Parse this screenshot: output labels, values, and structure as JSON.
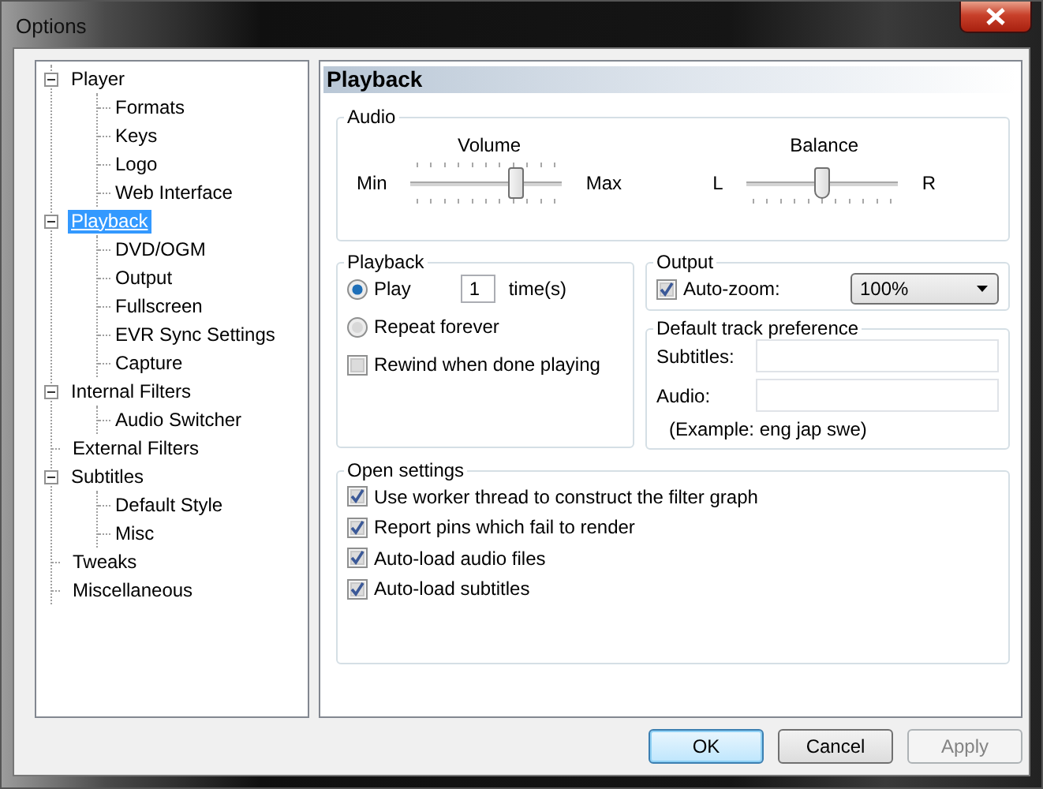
{
  "window": {
    "title": "Options"
  },
  "tree": [
    {
      "label": "Player",
      "selected": false,
      "expanded": true,
      "children": [
        {
          "label": "Formats",
          "selected": false
        },
        {
          "label": "Keys",
          "selected": false
        },
        {
          "label": "Logo",
          "selected": false
        },
        {
          "label": "Web Interface",
          "selected": false
        }
      ]
    },
    {
      "label": "Playback",
      "selected": true,
      "expanded": true,
      "children": [
        {
          "label": "DVD/OGM",
          "selected": false
        },
        {
          "label": "Output",
          "selected": false
        },
        {
          "label": "Fullscreen",
          "selected": false
        },
        {
          "label": "EVR Sync Settings",
          "selected": false
        },
        {
          "label": "Capture",
          "selected": false
        }
      ]
    },
    {
      "label": "Internal Filters",
      "selected": false,
      "expanded": true,
      "children": [
        {
          "label": "Audio Switcher",
          "selected": false
        }
      ]
    },
    {
      "label": "External Filters",
      "selected": false
    },
    {
      "label": "Subtitles",
      "selected": false,
      "expanded": true,
      "children": [
        {
          "label": "Default Style",
          "selected": false
        },
        {
          "label": "Misc",
          "selected": false
        }
      ]
    },
    {
      "label": "Tweaks",
      "selected": false
    },
    {
      "label": "Miscellaneous",
      "selected": false
    }
  ],
  "page": {
    "title": "Playback"
  },
  "audio": {
    "title": "Audio",
    "sliders": [
      {
        "label": "Volume",
        "min_label": "Min",
        "max_label": "Max",
        "level": 0.69,
        "kind": "block"
      },
      {
        "label": "Balance",
        "min_label": "L",
        "max_label": "R",
        "level": 0.5,
        "kind": "pointer"
      }
    ]
  },
  "playback": {
    "title": "Playback",
    "options": [
      {
        "kind": "radio",
        "label": "Play",
        "selected": true,
        "count": "1",
        "suffix": "time(s)"
      },
      {
        "kind": "radio",
        "label": "Repeat forever",
        "selected": false
      },
      {
        "kind": "checkbox",
        "label": "Rewind when done playing",
        "checked": false
      }
    ]
  },
  "output": {
    "title": "Output",
    "auto_zoom": {
      "label": "Auto-zoom:",
      "checked": true
    },
    "zoom": {
      "value": "100%"
    }
  },
  "track_preference": {
    "title": "Default track preference",
    "fields": [
      {
        "label": "Subtitles:"
      },
      {
        "label": "Audio:"
      }
    ],
    "example": "(Example: eng jap swe)"
  },
  "open_settings": {
    "title": "Open settings",
    "options": [
      {
        "label": "Use worker thread to construct the filter graph",
        "checked": true
      },
      {
        "label": "Report pins which fail to render",
        "checked": true
      },
      {
        "label": "Auto-load audio files",
        "checked": true
      },
      {
        "label": "Auto-load subtitles",
        "checked": true
      }
    ]
  },
  "buttons": [
    {
      "label": "OK",
      "default": true,
      "disabled": false
    },
    {
      "label": "Cancel",
      "default": false,
      "disabled": false
    },
    {
      "label": "Apply",
      "default": false,
      "disabled": true
    }
  ]
}
